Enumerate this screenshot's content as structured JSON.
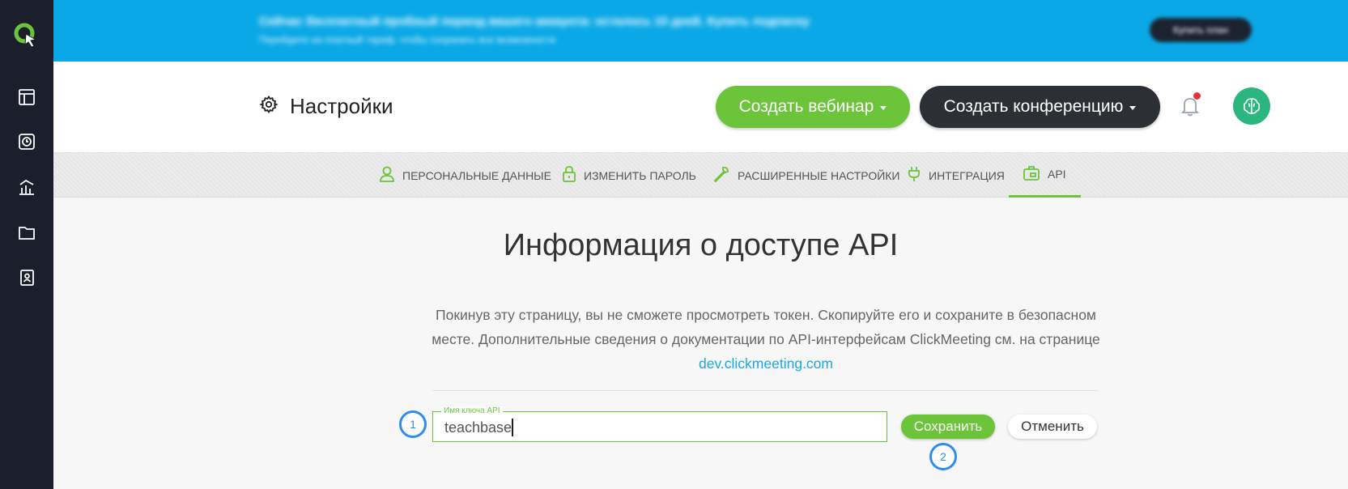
{
  "banner": {
    "text": "Сейчас бесплатный пробный период вашего аккаунта: осталось 10 дней. Купить подписку",
    "subtext": "Перейдите на платный тариф, чтобы сохранить все возможности",
    "button_label": "Купить план"
  },
  "header": {
    "title": "Настройки",
    "create_webinar_label": "Создать вебинар",
    "create_conference_label": "Создать конференцию"
  },
  "tabs": [
    {
      "label": "ПЕРСОНАЛЬНЫЕ ДАННЫЕ",
      "icon": "user-icon"
    },
    {
      "label": "ИЗМЕНИТЬ ПАРОЛЬ",
      "icon": "lock-icon"
    },
    {
      "label": "РАСШИРЕННЫЕ НАСТРОЙКИ",
      "icon": "wrench-icon"
    },
    {
      "label": "ИНТЕГРАЦИЯ",
      "icon": "plug-icon"
    },
    {
      "label": "API",
      "icon": "api-icon",
      "active": true
    }
  ],
  "content": {
    "title": "Информация о доступе API",
    "description": "Покинув эту страницу, вы не сможете просмотреть токен. Скопируйте его и сохраните в безопасном месте. Дополнительные сведения о документации по API-интерфейсам ClickMeeting см. на странице",
    "doc_link": "dev.clickmeeting.com"
  },
  "form": {
    "field_label": "Имя ключа API",
    "field_value": "teachbase",
    "save_label": "Сохранить",
    "cancel_label": "Отменить"
  },
  "markers": [
    "1",
    "2"
  ],
  "colors": {
    "accent_green": "#6cc43b",
    "banner_blue": "#0aa8e6",
    "sidebar_dark": "#1b1e2b",
    "marker_blue": "#2f8cf0"
  }
}
